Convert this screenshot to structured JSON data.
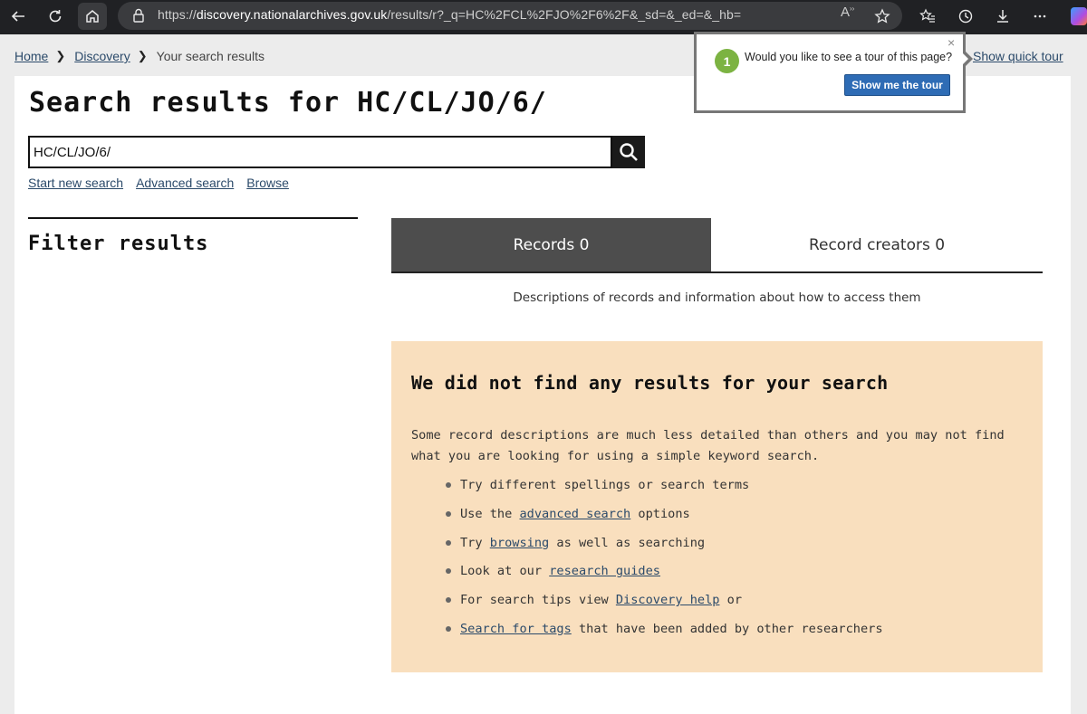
{
  "browser": {
    "url_prefix": "https://",
    "url_host": "discovery.nationalarchives.gov.uk",
    "url_path": "/results/r?_q=HC%2FCL%2FJO%2F6%2F&_sd=&_ed=&_hb=",
    "read_aloud_label": "A"
  },
  "breadcrumb": {
    "home": "Home",
    "discovery": "Discovery",
    "current": "Your search results"
  },
  "quick_tour_link": "Show quick tour",
  "tour_popup": {
    "step": "1",
    "question": "Would you like to see a tour of this page?",
    "button": "Show me the tour",
    "close": "×"
  },
  "page_title": "Search results for HC/CL/JO/6/",
  "search": {
    "value": "HC/CL/JO/6/",
    "links": [
      "Start new search",
      "Advanced search",
      "Browse"
    ]
  },
  "filter": {
    "title": "Filter results"
  },
  "tabs": {
    "records": "Records 0",
    "creators": "Record creators 0",
    "description": "Descriptions of records and information about how to access them"
  },
  "no_results": {
    "title": "We did not find any results for your search",
    "intro": "Some record descriptions are much less detailed than others and you may not find what you are looking for using a simple keyword search.",
    "tips": [
      {
        "before": "Try different spellings or search terms",
        "link": "",
        "after": ""
      },
      {
        "before": "Use the ",
        "link": "advanced search",
        "after": " options"
      },
      {
        "before": "Try ",
        "link": "browsing",
        "after": " as well as searching"
      },
      {
        "before": "Look at our ",
        "link": "research guides",
        "after": ""
      },
      {
        "before": "For search tips view ",
        "link": "Discovery help",
        "after": " or"
      },
      {
        "before": "",
        "link": "Search for tags",
        "after": " that have been added by other researchers"
      }
    ]
  },
  "colors": {
    "link": "#2b4a6a",
    "active_tab": "#4d4d4d",
    "no_results_bg": "#f9dfbe",
    "tour_button": "#2e6cb5",
    "tour_step": "#7cb342"
  }
}
